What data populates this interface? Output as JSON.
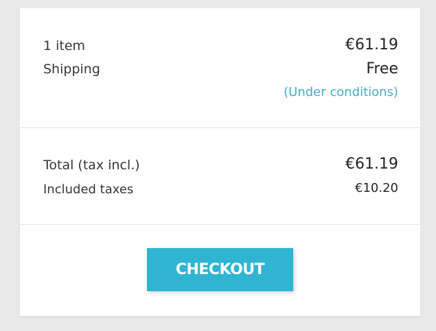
{
  "summary": {
    "items_label": "1 item",
    "items_value": "€61.19",
    "shipping_label": "Shipping",
    "shipping_value": "Free",
    "conditions_link": "(Under conditions)"
  },
  "totals": {
    "total_label": "Total (tax incl.)",
    "total_value": "€61.19",
    "taxes_label": "Included taxes",
    "taxes_value": "€10.20"
  },
  "actions": {
    "checkout_label": "CHECKOUT"
  },
  "colors": {
    "accent": "#2fb5d2",
    "link": "#3faecb",
    "page_background": "#e9e9e9",
    "card_background": "#ffffff"
  }
}
